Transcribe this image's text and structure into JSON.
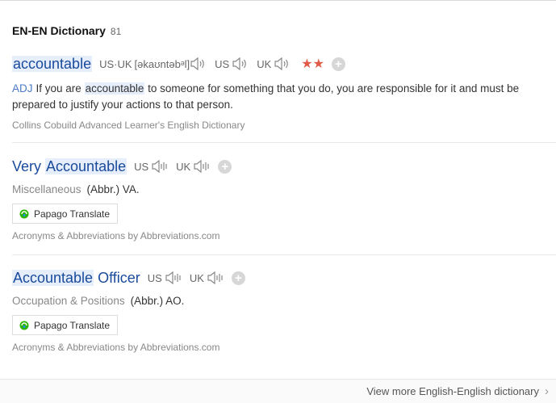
{
  "header": {
    "title": "EN-EN Dictionary",
    "count": "81"
  },
  "entries": [
    {
      "word_before": "",
      "word_hl": "accountable",
      "word_after": "",
      "pron_combined_label": "US·UK",
      "phonetic": "[əkaʊntəbᵊl]",
      "us_label": "US",
      "uk_label": "UK",
      "stars": "★★",
      "pos": "ADJ",
      "def_before": "If you are ",
      "def_hl": "accountable",
      "def_after": " to someone for something that you do, you are responsible for it and must be prepared to justify your actions to that person.",
      "source": "Collins Cobuild Advanced Learner's English Dictionary"
    },
    {
      "word_before": "Very ",
      "word_hl": "Accountable",
      "word_after": "",
      "us_label": "US",
      "uk_label": "UK",
      "category": "Miscellaneous",
      "abbr": "(Abbr.) VA.",
      "papago": "Papago Translate",
      "source": "Acronyms & Abbreviations by Abbreviations.com"
    },
    {
      "word_before": "",
      "word_hl": "Accountable",
      "word_after": " Officer",
      "us_label": "US",
      "uk_label": "UK",
      "category": "Occupation & Positions",
      "abbr": "(Abbr.) AO.",
      "papago": "Papago Translate",
      "source": "Acronyms & Abbreviations by Abbreviations.com"
    }
  ],
  "footer": {
    "link": "View more English-English dictionary"
  },
  "colors": {
    "word": "#1a4a9c",
    "highlight": "#e5eefa",
    "stars": "#e05a47",
    "pos": "#4a7ac8"
  }
}
